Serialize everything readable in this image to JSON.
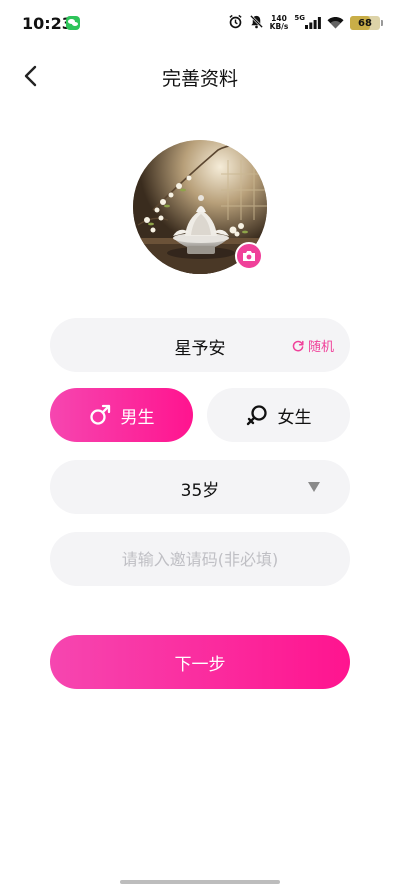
{
  "status_bar": {
    "time": "10:23",
    "net_speed_value": "140",
    "net_speed_unit": "KB/s",
    "network_type": "5G",
    "battery": "68",
    "battery_level": 0.68
  },
  "header": {
    "title": "完善资料",
    "back_icon": "chevron-left-icon"
  },
  "avatar": {
    "camera_icon": "camera-icon"
  },
  "form": {
    "nickname": "星予安",
    "random_label": "随机",
    "gender": {
      "male_label": "男生",
      "female_label": "女生",
      "selected": "male"
    },
    "age": "35岁",
    "invite_placeholder": "请输入邀请码(非必填)",
    "invite_value": ""
  },
  "actions": {
    "next_label": "下一步"
  },
  "colors": {
    "accent_start": "#f646b0",
    "accent_end": "#ff148f",
    "field_bg": "#f4f4f6"
  }
}
